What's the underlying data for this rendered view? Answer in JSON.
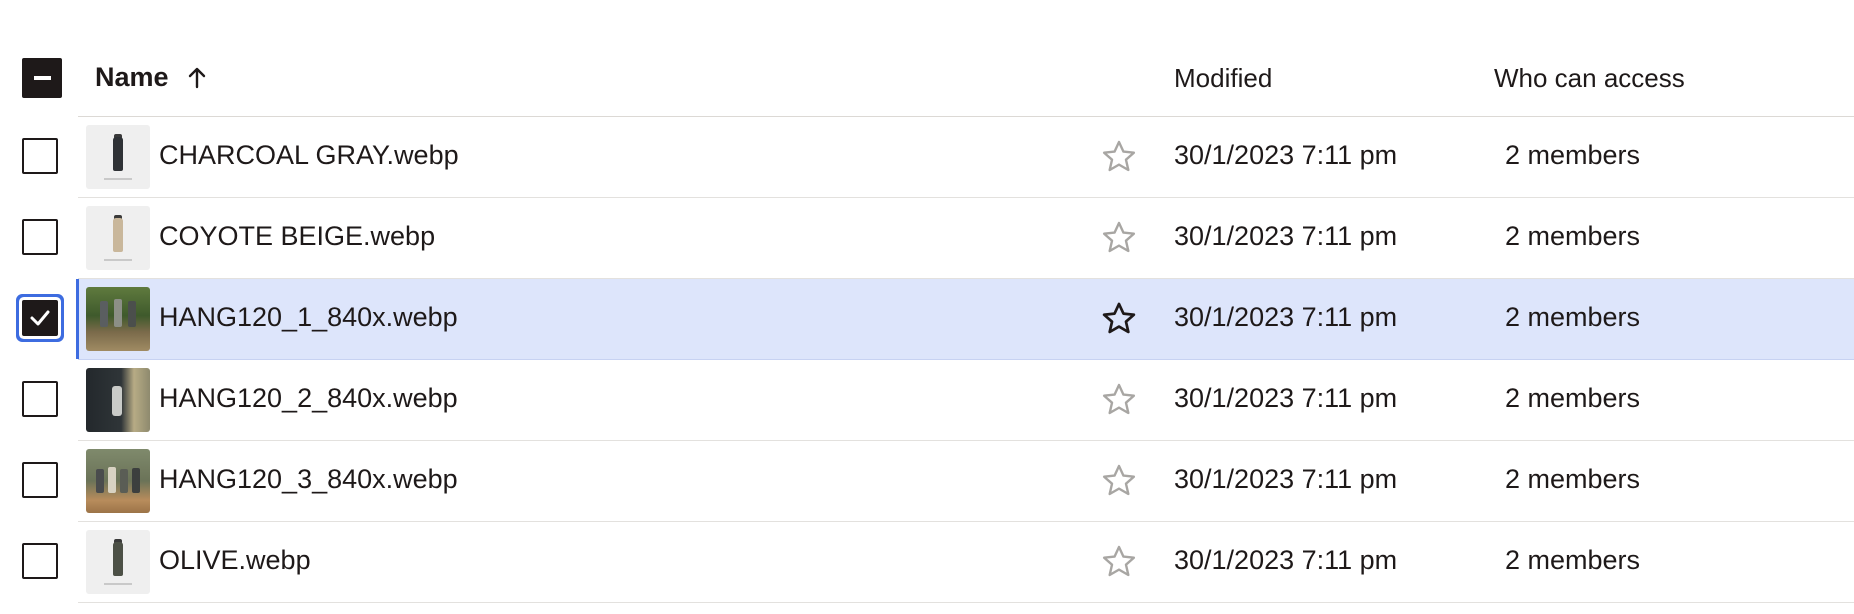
{
  "table": {
    "header": {
      "name_label": "Name",
      "modified_label": "Modified",
      "access_label": "Who can access",
      "sort_icon": "arrow-up-icon",
      "select_all_state": "indeterminate"
    },
    "rows": [
      {
        "name": "CHARCOAL GRAY.webp",
        "modified": "30/1/2023 7:11 pm",
        "access": "2 members",
        "selected": false,
        "thumb": "charcoal-bottle"
      },
      {
        "name": "COYOTE BEIGE.webp",
        "modified": "30/1/2023 7:11 pm",
        "access": "2 members",
        "selected": false,
        "thumb": "beige-bottle"
      },
      {
        "name": "HANG120_1_840x.webp",
        "modified": "30/1/2023 7:11 pm",
        "access": "2 members",
        "selected": true,
        "thumb": "outdoor-photo"
      },
      {
        "name": "HANG120_2_840x.webp",
        "modified": "30/1/2023 7:11 pm",
        "access": "2 members",
        "selected": false,
        "thumb": "backpack-photo"
      },
      {
        "name": "HANG120_3_840x.webp",
        "modified": "30/1/2023 7:11 pm",
        "access": "2 members",
        "selected": false,
        "thumb": "bottles-photo"
      },
      {
        "name": "OLIVE.webp",
        "modified": "30/1/2023 7:11 pm",
        "access": "2 members",
        "selected": false,
        "thumb": "olive-bottle"
      }
    ]
  },
  "colors": {
    "selection_bg": "#dde5fb",
    "selection_accent": "#3d6ce0",
    "text": "#1e1919",
    "star_idle": "#a8a6a3"
  }
}
